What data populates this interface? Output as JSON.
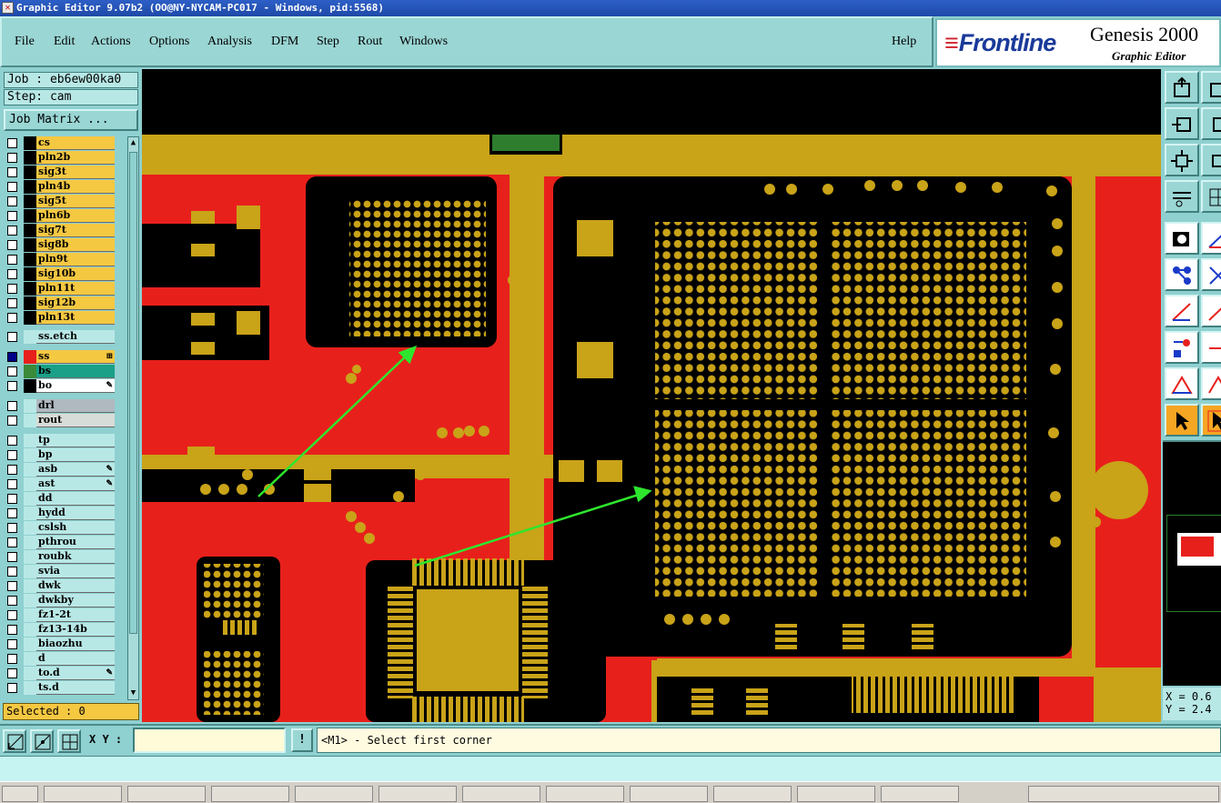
{
  "window": {
    "title": "Graphic Editor 9.07b2 (OO@NY-NYCAM-PC017 - Windows, pid:5568)"
  },
  "menu": {
    "items": [
      "File",
      "Edit",
      "Actions",
      "Options",
      "Analysis",
      "DFM",
      "Step",
      "Rout",
      "Windows"
    ],
    "help": "Help"
  },
  "brand": {
    "logo": "Frontline",
    "product": "Genesis 2000",
    "subtitle": "Graphic Editor"
  },
  "job": {
    "job_label": "Job : eb6ew00ka0",
    "step_label": "Step: cam",
    "matrix_button": "Job Matrix ..."
  },
  "layers": [
    {
      "name": "cs",
      "color": "#f5c842",
      "swatch": "#000000",
      "checked": false
    },
    {
      "name": "pln2b",
      "color": "#f5c842",
      "swatch": "#000000",
      "checked": false
    },
    {
      "name": "sig3t",
      "color": "#f5c842",
      "swatch": "#000000",
      "checked": false
    },
    {
      "name": "pln4b",
      "color": "#f5c842",
      "swatch": "#000000",
      "checked": false
    },
    {
      "name": "sig5t",
      "color": "#f5c842",
      "swatch": "#000000",
      "checked": false
    },
    {
      "name": "pln6b",
      "color": "#f5c842",
      "swatch": "#000000",
      "checked": false
    },
    {
      "name": "sig7t",
      "color": "#f5c842",
      "swatch": "#000000",
      "checked": false
    },
    {
      "name": "sig8b",
      "color": "#f5c842",
      "swatch": "#000000",
      "checked": false
    },
    {
      "name": "pln9t",
      "color": "#f5c842",
      "swatch": "#000000",
      "checked": false
    },
    {
      "name": "sig10b",
      "color": "#f5c842",
      "swatch": "#000000",
      "checked": false
    },
    {
      "name": "pln11t",
      "color": "#f5c842",
      "swatch": "#000000",
      "checked": false
    },
    {
      "name": "sig12b",
      "color": "#f5c842",
      "swatch": "#000000",
      "checked": false
    },
    {
      "name": "pln13t",
      "color": "#f5c842",
      "swatch": "#000000",
      "checked": false
    },
    {
      "name": "ss.etch",
      "color": "#b8e8e6",
      "swatch": "#b8e8e6",
      "checked": false
    },
    {
      "name": "ss",
      "color": "#f5c842",
      "swatch": "#e8201c",
      "checked": true,
      "mark": "⊞"
    },
    {
      "name": "bs",
      "color": "#1aa088",
      "swatch": "#3a8a3a",
      "checked": false
    },
    {
      "name": "bo",
      "color": "#ffffff",
      "swatch": "#000000",
      "checked": false,
      "mark": "✎"
    },
    {
      "name": "drl",
      "color": "#b0b8c0",
      "swatch": "#b8e8e6",
      "checked": false
    },
    {
      "name": "rout",
      "color": "#d8dcd8",
      "swatch": "#b8e8e6",
      "checked": false
    },
    {
      "name": "tp",
      "color": "#b8e8e6",
      "swatch": "#b8e8e6",
      "checked": false
    },
    {
      "name": "bp",
      "color": "#b8e8e6",
      "swatch": "#b8e8e6",
      "checked": false
    },
    {
      "name": "asb",
      "color": "#b8e8e6",
      "swatch": "#b8e8e6",
      "checked": false,
      "mark": "✎"
    },
    {
      "name": "ast",
      "color": "#b8e8e6",
      "swatch": "#b8e8e6",
      "checked": false,
      "mark": "✎"
    },
    {
      "name": "dd",
      "color": "#b8e8e6",
      "swatch": "#b8e8e6",
      "checked": false
    },
    {
      "name": "hydd",
      "color": "#b8e8e6",
      "swatch": "#b8e8e6",
      "checked": false
    },
    {
      "name": "cslsh",
      "color": "#b8e8e6",
      "swatch": "#b8e8e6",
      "checked": false
    },
    {
      "name": "pthrou",
      "color": "#b8e8e6",
      "swatch": "#b8e8e6",
      "checked": false
    },
    {
      "name": "roubk",
      "color": "#b8e8e6",
      "swatch": "#b8e8e6",
      "checked": false
    },
    {
      "name": "svia",
      "color": "#b8e8e6",
      "swatch": "#b8e8e6",
      "checked": false
    },
    {
      "name": "dwk",
      "color": "#b8e8e6",
      "swatch": "#b8e8e6",
      "checked": false
    },
    {
      "name": "dwkby",
      "color": "#b8e8e6",
      "swatch": "#b8e8e6",
      "checked": false
    },
    {
      "name": "fz1-2t",
      "color": "#b8e8e6",
      "swatch": "#b8e8e6",
      "checked": false
    },
    {
      "name": "fz13-14b",
      "color": "#b8e8e6",
      "swatch": "#b8e8e6",
      "checked": false
    },
    {
      "name": "biaozhu",
      "color": "#b8e8e6",
      "swatch": "#b8e8e6",
      "checked": false
    },
    {
      "name": "d",
      "color": "#b8e8e6",
      "swatch": "#b8e8e6",
      "checked": false
    },
    {
      "name": "to.d",
      "color": "#b8e8e6",
      "swatch": "#b8e8e6",
      "checked": false,
      "mark": "✎"
    },
    {
      "name": "ts.d",
      "color": "#b8e8e6",
      "swatch": "#b8e8e6",
      "checked": false
    }
  ],
  "selected_label": "Selected : 0",
  "coords": {
    "x": "X = 0.6",
    "y": "Y = 2.4"
  },
  "command": {
    "xy_label": "X Y :",
    "xy_value": "",
    "info_button": "!",
    "prompt": "<M1> - Select first corner"
  },
  "colors": {
    "copper": "#e8201c",
    "pad": "#c9a318",
    "background": "#000000",
    "arrow": "#2ee62e",
    "panel": "#8fd0d0"
  }
}
